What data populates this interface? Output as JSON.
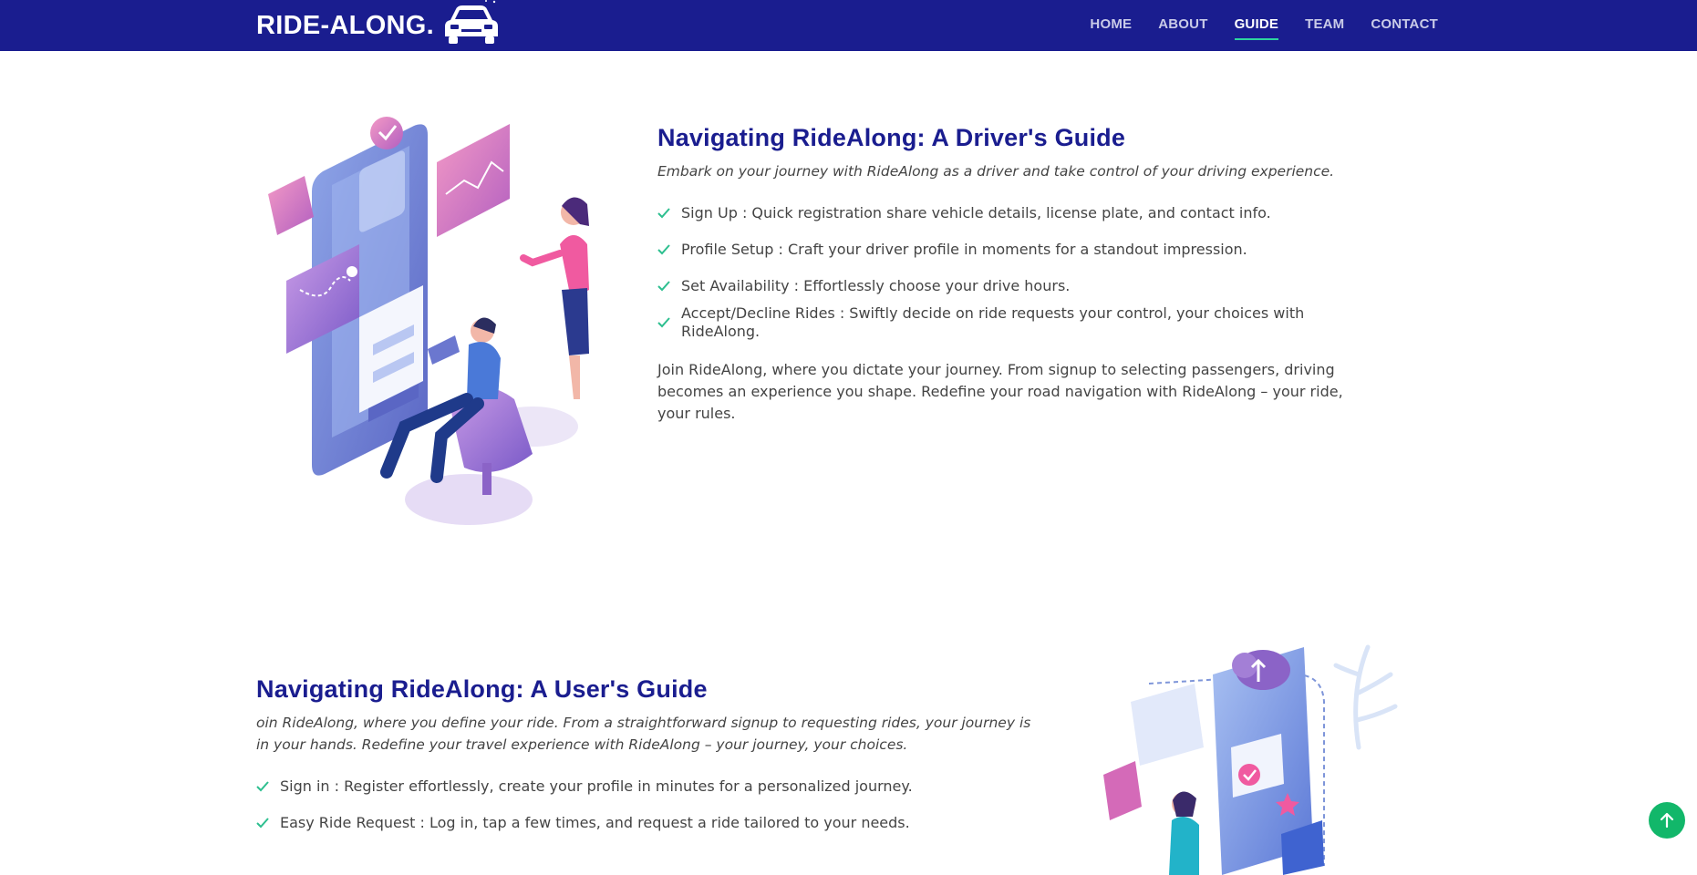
{
  "header": {
    "logo_text": "RIDE-ALONG.",
    "nav": [
      "HOME",
      "ABOUT",
      "GUIDE",
      "TEAM",
      "CONTACT"
    ],
    "active": "GUIDE"
  },
  "driver": {
    "title": "Navigating RideAlong: A Driver's Guide",
    "lead": "Embark on your journey with RideAlong as a driver and take control of your driving experience.",
    "items": [
      "Sign Up : Quick registration share vehicle details, license plate, and contact info.",
      "Profile Setup : Craft your driver profile in moments for a standout impression.",
      "Set Availability : Effortlessly choose your drive hours.",
      "Accept/Decline Rides : Swiftly decide on ride requests your control, your choices with RideAlong."
    ],
    "paragraph": "Join RideAlong, where you dictate your journey. From signup to selecting passengers, driving becomes an experience you shape. Redefine your road navigation with RideAlong – your ride, your rules."
  },
  "user": {
    "title": "Navigating RideAlong: A User's Guide",
    "lead": "oin RideAlong, where you define your ride. From a straightforward signup to requesting rides, your journey is in your hands. Redefine your travel experience with RideAlong – your journey, your choices.",
    "items": [
      "Sign in : Register effortlessly, create your profile in minutes for a personalized journey.",
      "Easy Ride Request : Log in, tap a few times, and request a ride tailored to your needs."
    ]
  },
  "colors": {
    "header_bg": "#1a1d8f",
    "accent": "#2dd4a0",
    "title": "#1a1d8f",
    "back_to_top": "#12b76a"
  },
  "icons": {
    "logo": "car-icon",
    "list_marker": "check-icon",
    "back_to_top": "arrow-up-icon"
  }
}
